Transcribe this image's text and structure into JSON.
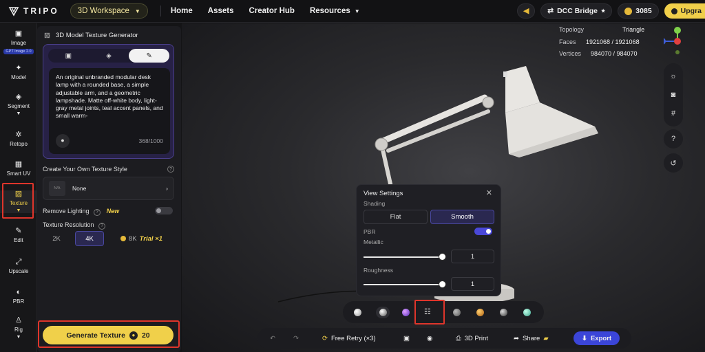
{
  "topbar": {
    "brand": "TRIPO",
    "workspace": "3D Workspace",
    "nav": [
      "Home",
      "Assets",
      "Creator Hub",
      "Resources"
    ],
    "dcc": "DCC Bridge",
    "credits": "3085",
    "upgrade": "Upgra"
  },
  "sidebar": {
    "items": [
      {
        "label": "Image",
        "badge": "GPT Image 2.0",
        "icon": "image-icon"
      },
      {
        "label": "Model",
        "icon": "sparkle-icon"
      },
      {
        "label": "Segment",
        "icon": "cube-icon"
      },
      {
        "label": "Retopo",
        "icon": "mesh-icon"
      },
      {
        "label": "Smart UV",
        "icon": "uv-icon"
      },
      {
        "label": "Texture",
        "icon": "texture-icon"
      },
      {
        "label": "Edit",
        "icon": "brush-icon"
      },
      {
        "label": "Upscale",
        "icon": "upscale-icon"
      },
      {
        "label": "PBR",
        "icon": "pbr-icon"
      },
      {
        "label": "Rig",
        "icon": "rig-icon"
      }
    ]
  },
  "panel": {
    "title": "3D Model Texture Generator",
    "prompt": "An original unbranded modular desk lamp with a rounded base, a simple adjustable arm, and a geometric lampshade. Matte off-white body, light-gray metal joints, teal accent panels, and small warm-",
    "count": "368/1000",
    "style_label": "Create Your Own Texture Style",
    "style_thumb": "N/A",
    "style_value": "None",
    "remove_lighting": "Remove Lighting",
    "new_tag": "New",
    "resolution_label": "Texture Resolution",
    "res_options": [
      "2K",
      "4K",
      "8K"
    ],
    "trial": "Trial ×1",
    "generate": "Generate Texture",
    "generate_cost": "20"
  },
  "stats": {
    "topology_label": "Topology",
    "topology": "Triangle",
    "faces_label": "Faces",
    "faces": "1921068 / 1921068",
    "vertices_label": "Vertices",
    "vertices": "984070 / 984070"
  },
  "view_settings": {
    "title": "View Settings",
    "shading": "Shading",
    "flat": "Flat",
    "smooth": "Smooth",
    "pbr": "PBR",
    "metallic": "Metallic",
    "metallic_val": "1",
    "roughness": "Roughness",
    "roughness_val": "1"
  },
  "bottombar": {
    "free_retry": "Free Retry (×3)",
    "print": "3D Print",
    "share": "Share",
    "export": "Export"
  },
  "colors": {
    "accent": "#f0d04a",
    "highlight": "#e0352b",
    "export": "#3b45d8"
  }
}
